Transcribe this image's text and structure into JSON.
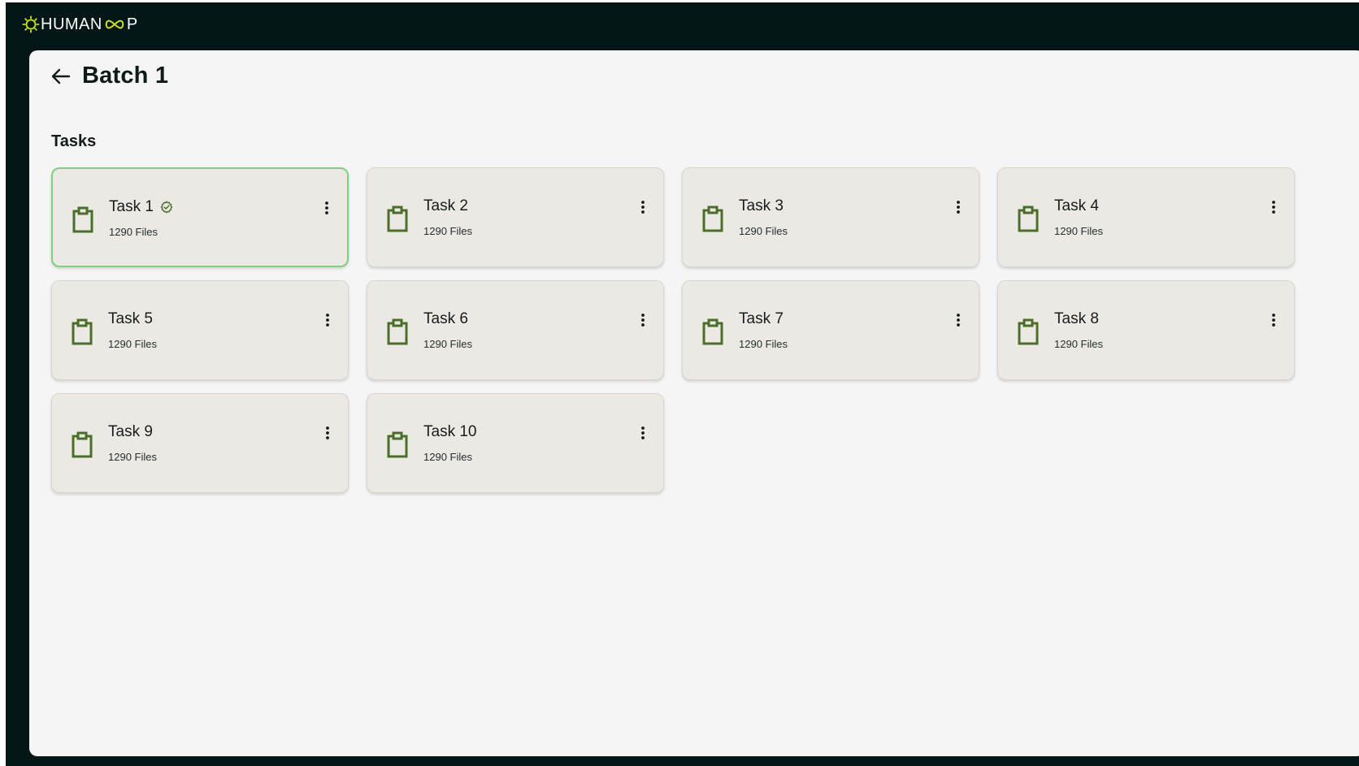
{
  "branding": {
    "logo_left": "HUMAN",
    "logo_right": "P"
  },
  "header": {
    "back_icon": "arrow-left-icon",
    "title": "Batch 1"
  },
  "section": {
    "title": "Tasks"
  },
  "tasks": [
    {
      "title": "Task 1",
      "files": "1290 Files",
      "selected": true,
      "verified": true
    },
    {
      "title": "Task 2",
      "files": "1290 Files",
      "selected": false,
      "verified": false
    },
    {
      "title": "Task 3",
      "files": "1290 Files",
      "selected": false,
      "verified": false
    },
    {
      "title": "Task 4",
      "files": "1290 Files",
      "selected": false,
      "verified": false
    },
    {
      "title": "Task 5",
      "files": "1290 Files",
      "selected": false,
      "verified": false
    },
    {
      "title": "Task 6",
      "files": "1290 Files",
      "selected": false,
      "verified": false
    },
    {
      "title": "Task 7",
      "files": "1290 Files",
      "selected": false,
      "verified": false
    },
    {
      "title": "Task 8",
      "files": "1290 Files",
      "selected": false,
      "verified": false
    },
    {
      "title": "Task 9",
      "files": "1290 Files",
      "selected": false,
      "verified": false
    },
    {
      "title": "Task 10",
      "files": "1290 Files",
      "selected": false,
      "verified": false
    }
  ],
  "icons": {
    "task_icon": "clipboard-icon",
    "verified_icon": "verified-badge-icon",
    "more_icon": "more-vertical-icon"
  },
  "colors": {
    "app_background": "#041615",
    "panel_background": "#f5f5f5",
    "card_background": "#ece9e4",
    "selected_border": "#7dd37d",
    "icon_green": "#4a6f2a",
    "logo_yellow_green": "#c8dd22"
  }
}
